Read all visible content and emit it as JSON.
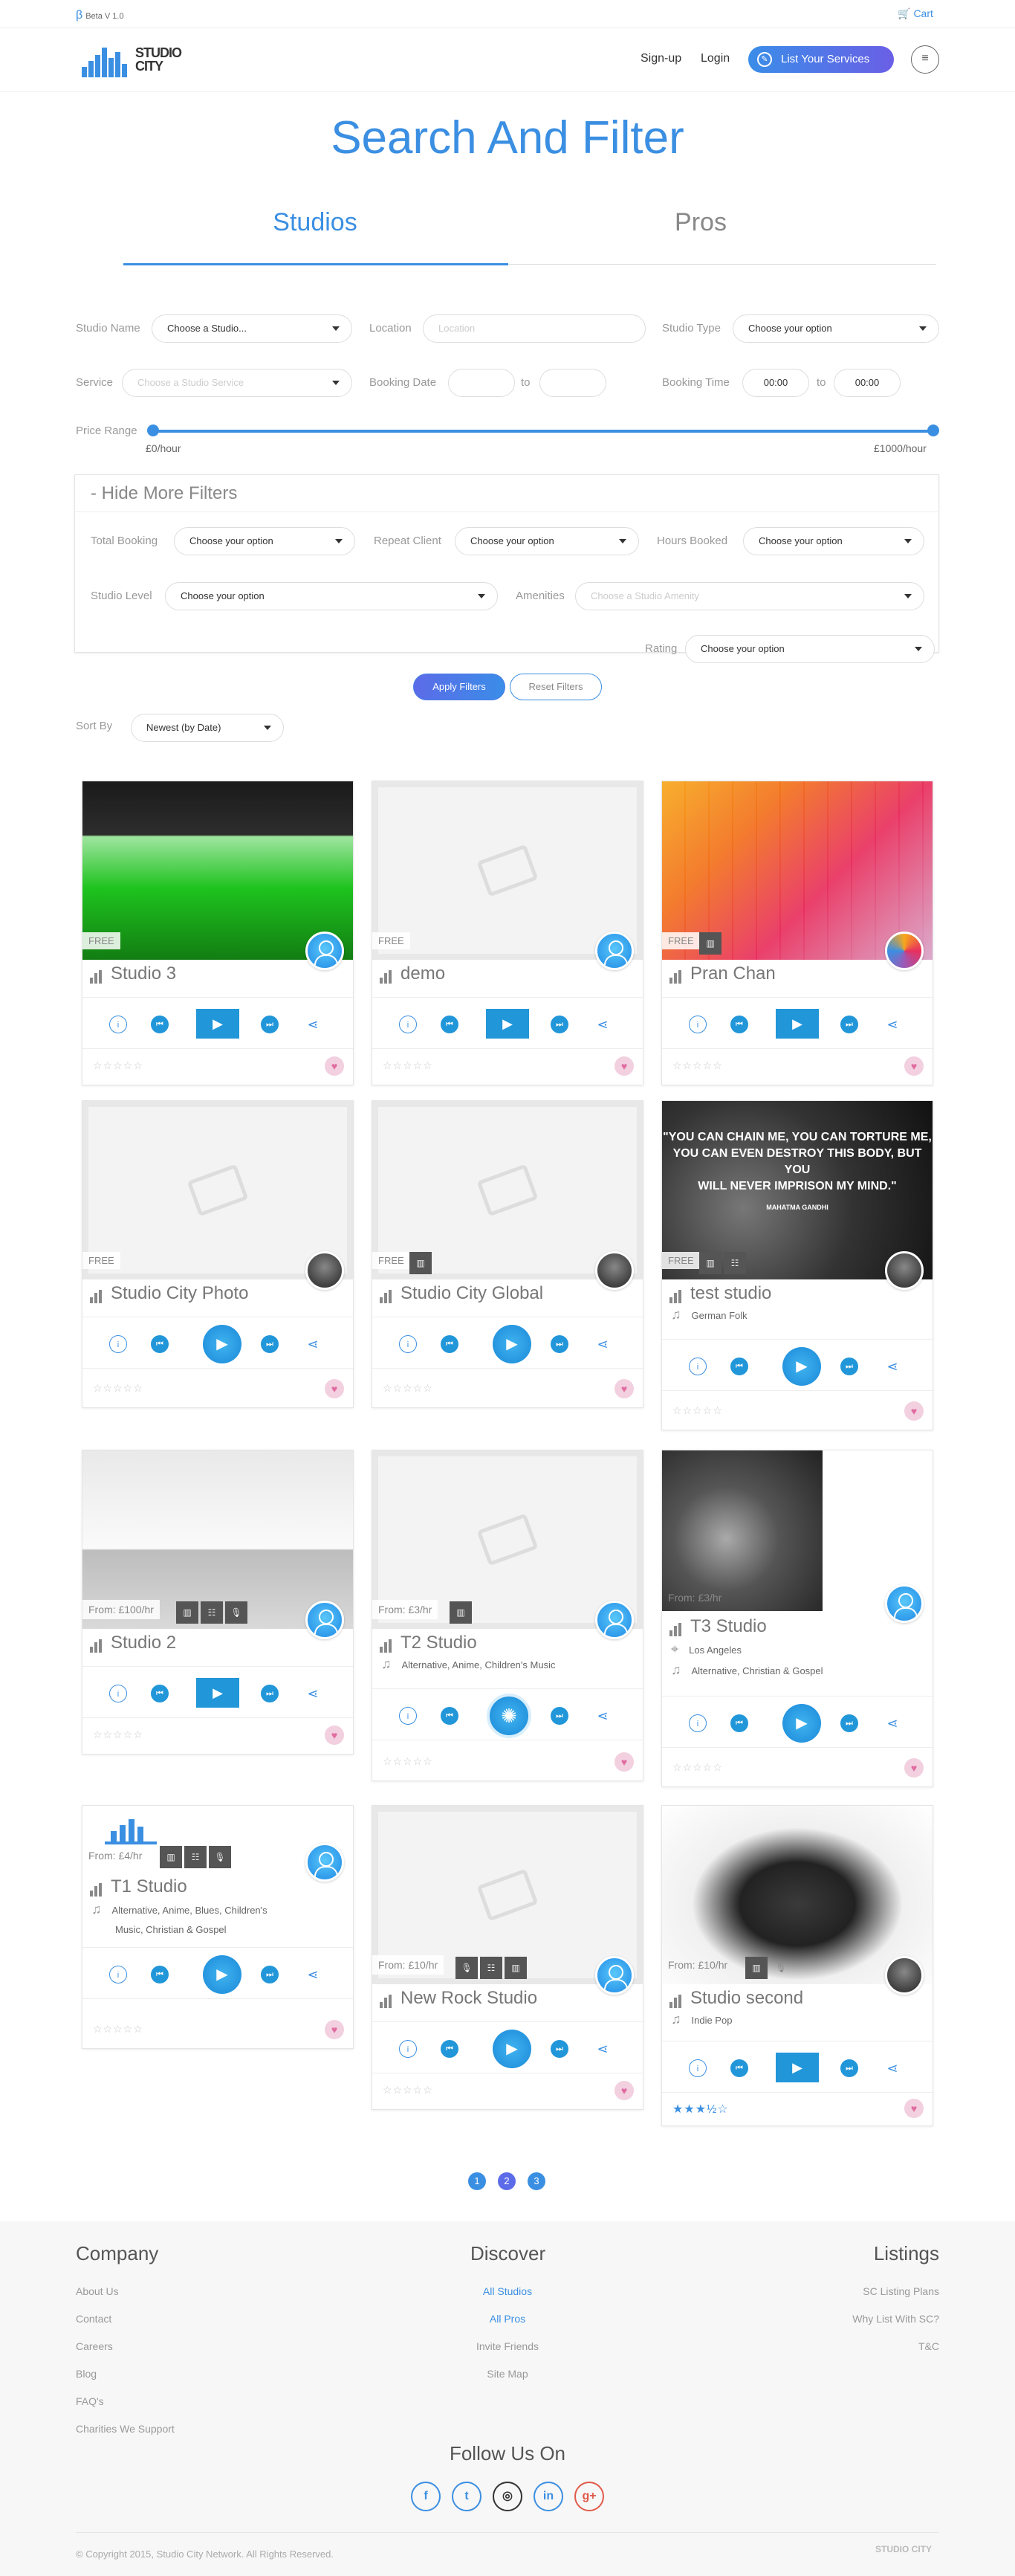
{
  "topbar": {
    "beta_symbol": "β",
    "beta": "Beta V 1.0",
    "cart": "Cart"
  },
  "header": {
    "logo_line1": "STUDIO",
    "logo_line2": "CITY",
    "signup": "Sign-up",
    "login": "Login",
    "list_services": "List Your Services"
  },
  "page": {
    "title": "Search And Filter"
  },
  "tabs": [
    {
      "label": "Studios",
      "active": true
    },
    {
      "label": "Pros",
      "active": false
    }
  ],
  "filters": {
    "studio_name_label": "Studio Name",
    "studio_name_value": "Choose a Studio...",
    "location_label": "Location",
    "location_placeholder": "Location",
    "studio_type_label": "Studio Type",
    "studio_type_value": "Choose your option",
    "service_label": "Service",
    "service_placeholder": "Choose a Studio Service",
    "booking_date_label": "Booking Date",
    "to1": "to",
    "booking_time_label": "Booking Time",
    "time_from": "00:00",
    "to2": "to",
    "time_to": "00:00",
    "price_range_label": "Price Range",
    "price_min": "£0/hour",
    "price_max": "£1000/hour",
    "hide_more": "- Hide More Filters",
    "total_booking_label": "Total Booking",
    "total_booking_value": "Choose your option",
    "repeat_client_label": "Repeat Client",
    "repeat_client_value": "Choose your option",
    "hours_booked_label": "Hours Booked",
    "hours_booked_value": "Choose your option",
    "studio_level_label": "Studio Level",
    "studio_level_value": "Choose your option",
    "amenities_label": "Amenities",
    "amenities_placeholder": "Choose a Studio Amenity",
    "rating_label": "Rating",
    "rating_value": "Choose your option",
    "apply": "Apply Filters",
    "reset": "Reset Filters",
    "sort_label": "Sort By",
    "sort_value": "Newest (by Date)"
  },
  "studios": [
    {
      "name": "Studio 3",
      "tag": "FREE",
      "image": "green-screen",
      "rating": 0
    },
    {
      "name": "demo",
      "tag": "FREE",
      "image": "placeholder",
      "rating": 0
    },
    {
      "name": "Pran Chan",
      "tag": "FREE",
      "image": "pink-grid",
      "rating": 0
    },
    {
      "name": "Studio City Photo",
      "tag": "FREE",
      "image": "placeholder",
      "rating": 0
    },
    {
      "name": "Studio City Global",
      "tag": "FREE",
      "image": "placeholder",
      "rating": 0
    },
    {
      "name": "test studio",
      "tag": "FREE",
      "image": "quote",
      "genre": "German Folk",
      "rating": 0,
      "quote_line1": "\"YOU CAN CHAIN ME, YOU CAN TORTURE ME,",
      "quote_line2": "YOU CAN EVEN DESTROY THIS BODY, BUT YOU",
      "quote_line3": "WILL NEVER IMPRISON MY MIND.\"",
      "quote_author": "MAHATMA GANDHI"
    },
    {
      "name": "Studio 2",
      "tag": "From: £100/hr",
      "image": "photo-studio",
      "rating": 0
    },
    {
      "name": "T2 Studio",
      "tag": "From: £3/hr",
      "image": "placeholder",
      "genre": "Alternative,  Anime,  Children's Music",
      "rating": 0
    },
    {
      "name": "T3 Studio",
      "tag": "From: £3/hr",
      "image": "drums",
      "location": "Los Angeles",
      "genre": "Alternative,  Christian & Gospel",
      "rating": 0
    },
    {
      "name": "T1 Studio",
      "tag": "From: £4/hr",
      "image": "logo",
      "genre_line1": "Alternative,  Anime,  Blues,  Children's",
      "genre_line2": "Music,  Christian & Gospel",
      "rating": 0
    },
    {
      "name": "New Rock Studio",
      "tag": "From: £10/hr",
      "image": "placeholder",
      "rating": 0
    },
    {
      "name": "Studio second",
      "tag": "From: £10/hr",
      "image": "jeep",
      "genre": "Indie Pop",
      "rating": 3.5
    }
  ],
  "icons": {
    "stars_empty": "☆☆☆☆☆",
    "stars_partial": "★★★½☆",
    "heart": "♥",
    "play": "▶",
    "prev": "⏮",
    "next": "⏭",
    "info": "i",
    "share": "⋖"
  },
  "pagination": [
    "1",
    "2",
    "3"
  ],
  "footer": {
    "company_title": "Company",
    "company_links": [
      "About Us",
      "Contact",
      "Careers",
      "Blog",
      "FAQ's",
      "Charities We Support"
    ],
    "discover_title": "Discover",
    "discover_links": [
      "All Studios",
      "All Pros",
      "Invite Friends",
      "Site Map"
    ],
    "listings_title": "Listings",
    "listings_links": [
      "SC Listing Plans",
      "Why List With SC?",
      "T&C"
    ],
    "follow": "Follow Us On",
    "social": [
      "f",
      "t",
      "◎",
      "in",
      "g+"
    ],
    "copyright": "© Copyright 2015, Studio City Network. All Rights Reserved.",
    "logo": "STUDIO CITY"
  },
  "colors": {
    "accent": "#3b8fe2",
    "heart": "#e06ba0"
  }
}
